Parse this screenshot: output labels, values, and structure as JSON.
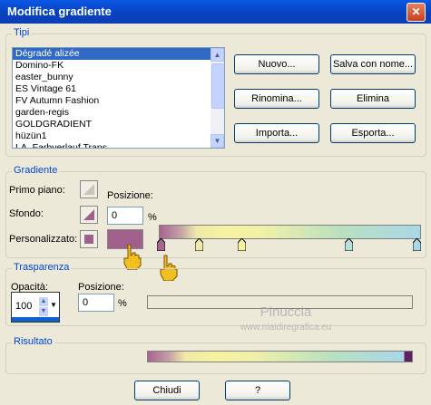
{
  "window": {
    "title": "Modifica gradiente",
    "close_label": "✕"
  },
  "tipi": {
    "label": "Tipi",
    "items": [
      "Dégradé alizée",
      "Domino-FK",
      "easter_bunny",
      "ES Vintage 61",
      "FV Autumn Fashion",
      "garden-regis",
      "GOLDGRADIENT",
      "hüzün1",
      "LA_Farbverlauf Trans"
    ],
    "selected_index": 0,
    "buttons": {
      "nuovo": "Nuovo...",
      "salva": "Salva con nome...",
      "rinomina": "Rinomina...",
      "elimina": "Elimina",
      "importa": "Importa...",
      "esporta": "Esporta..."
    }
  },
  "gradiente": {
    "label": "Gradiente",
    "primo_piano_label": "Primo piano:",
    "sfondo_label": "Sfondo:",
    "personalizzato_label": "Personalizzato:",
    "posizione_label": "Posizione:",
    "posizione_value": "0",
    "percent": "%",
    "custom_color": "#a0608c"
  },
  "trasparenza": {
    "label": "Trasparenza",
    "opacita_label": "Opacità:",
    "opacita_value": "100",
    "posizione_label": "Posizione:",
    "posizione_value": "0",
    "percent": "%"
  },
  "risultato": {
    "label": "Risultato"
  },
  "footer": {
    "chiudi": "Chiudi",
    "help": "?"
  },
  "watermark": {
    "name": "Pinuccia",
    "url": "www.maidiregrafica.eu"
  }
}
